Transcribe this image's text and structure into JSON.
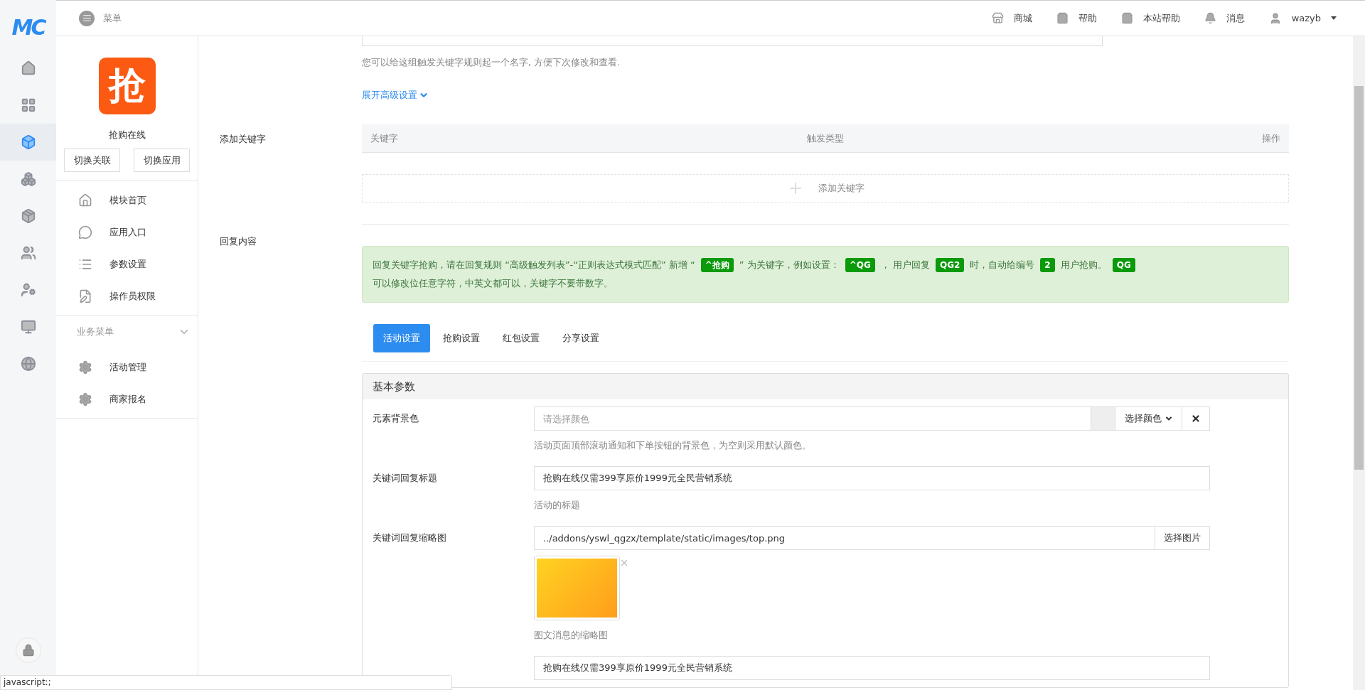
{
  "rail": {
    "brand": "MC",
    "items": [
      {
        "selected": false
      },
      {
        "selected": false
      },
      {
        "selected": true
      },
      {
        "selected": false
      },
      {
        "selected": false
      },
      {
        "selected": false
      },
      {
        "selected": false
      },
      {
        "selected": false
      },
      {
        "selected": false
      }
    ]
  },
  "header": {
    "menu_label": "菜单",
    "links": [
      {
        "label": "商城"
      },
      {
        "label": "帮助"
      },
      {
        "label": "本站帮助"
      },
      {
        "label": "消息"
      }
    ],
    "user": "wazyb"
  },
  "sidebar": {
    "logo_text": "抢",
    "app_name": "抢购在线",
    "buttons": [
      "切换关联",
      "切换应用"
    ],
    "items": [
      {
        "label": "模块首页"
      },
      {
        "label": "应用入口"
      },
      {
        "label": "参数设置"
      },
      {
        "label": "操作员权限"
      }
    ],
    "section": {
      "title": "业务菜单",
      "expanded": true,
      "items": [
        {
          "label": "活动管理"
        },
        {
          "label": "商家报名"
        }
      ]
    }
  },
  "form": {
    "rule_hint": "您可以给这组触发关键字规则起一个名字, 方便下次修改和查看.",
    "advanced_link": "展开高级设置",
    "keywords": {
      "label": "添加关键字",
      "columns": [
        "关键字",
        "触发类型",
        "操作"
      ],
      "add_label": "添加关键字"
    },
    "reply": {
      "label": "回复内容",
      "alert": [
        {
          "kind": "text",
          "text": "回复关键字抢购，请在回复规则 “高级触发列表”-“正则表达式模式匹配” 新增 “"
        },
        {
          "kind": "badge",
          "text": "^抢购"
        },
        {
          "kind": "text",
          "text": "” 为关键字，例如设置："
        },
        {
          "kind": "badge",
          "text": "^QG"
        },
        {
          "kind": "text",
          "text": "， 用户回复"
        },
        {
          "kind": "badge",
          "text": "QG2"
        },
        {
          "kind": "text",
          "text": "时，自动给编号"
        },
        {
          "kind": "badge",
          "text": "2"
        },
        {
          "kind": "text",
          "text": "用户抢购。"
        },
        {
          "kind": "badge",
          "text": "QG"
        },
        {
          "kind": "text",
          "text": "可以修改位任意字符，中英文都可以，关键字不要带数字。"
        }
      ],
      "tabs": [
        {
          "label": "活动设置",
          "selected": true
        },
        {
          "label": "抢购设置",
          "selected": false
        },
        {
          "label": "红包设置",
          "selected": false
        },
        {
          "label": "分享设置",
          "selected": false
        }
      ],
      "panel": {
        "title": "基本参数",
        "rows": [
          {
            "kind": "color",
            "label": "元素背景色",
            "placeholder": "请选择颜色",
            "button": "选择颜色",
            "hint": "活动页面顶部滚动通知和下单按钮的背景色，为空则采用默认颜色。"
          },
          {
            "kind": "text",
            "label": "关键词回复标题",
            "value": "抢购在线仅需399享原价1999元全民营销系统",
            "hint": "活动的标题"
          },
          {
            "kind": "image",
            "label": "关键词回复缩略图",
            "value": "../addons/yswl_qgzx/template/static/images/top.png",
            "button": "选择图片",
            "hint": "图文消息的缩略图"
          },
          {
            "kind": "text",
            "value": "抢购在线仅需399享原价1999元全民营销系统"
          }
        ]
      }
    }
  },
  "status_bar": "javascript:;"
}
